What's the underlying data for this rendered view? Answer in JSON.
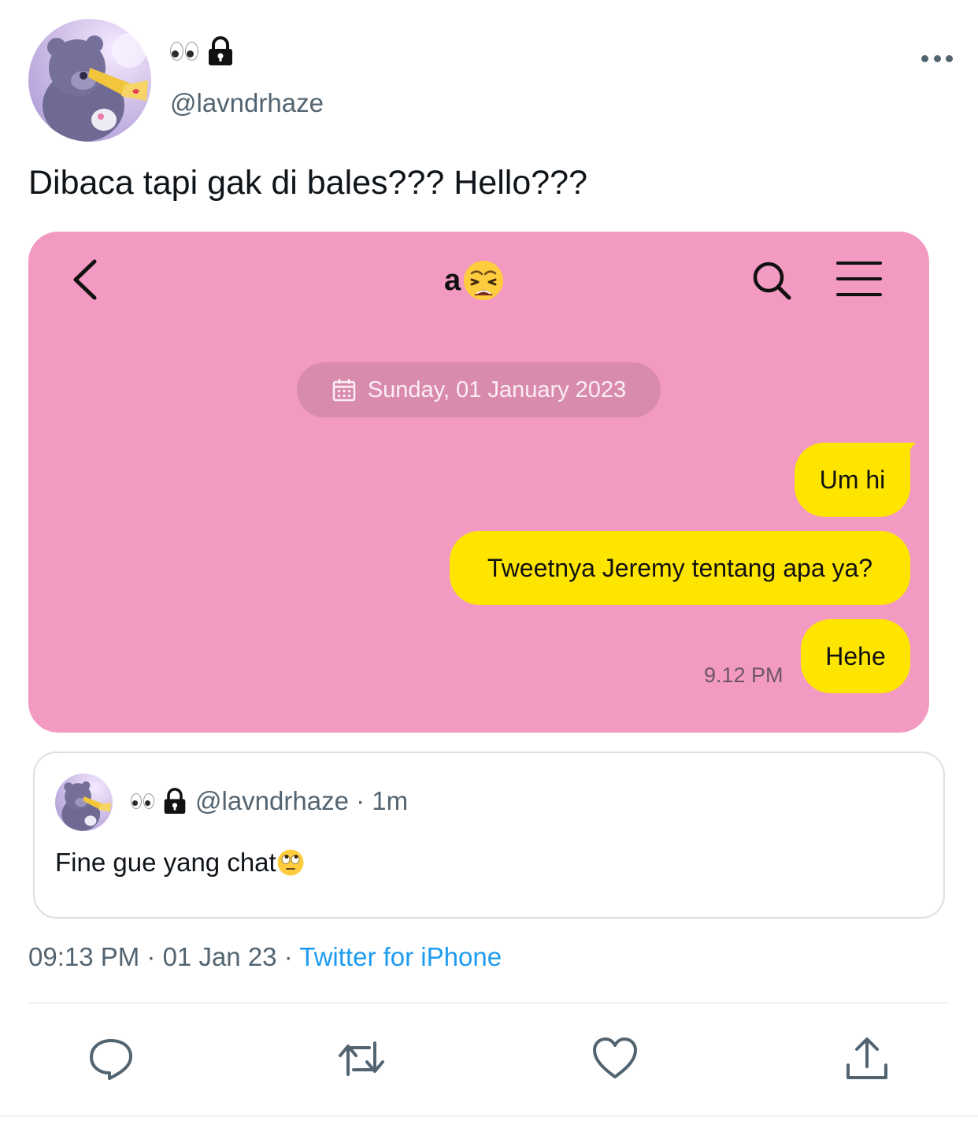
{
  "tweet": {
    "handle": "@lavndrhaze",
    "text": "Dibaca tapi gak di bales??? Hello???",
    "timestamp": "09:13 PM · 01 Jan 23 · ",
    "source": "Twitter for iPhone",
    "badges": [
      "eyes-emoji",
      "lock-icon"
    ],
    "more_icon": "more-horizontal-icon"
  },
  "chat": {
    "title": "a",
    "title_emoji": "weary-face-emoji",
    "date": "Sunday, 01 January 2023",
    "messages": [
      {
        "text": "Um hi"
      },
      {
        "text": "Tweetnya Jeremy tentang apa ya?"
      },
      {
        "text": "Hehe"
      }
    ],
    "time": "9.12 PM",
    "colors": {
      "background": "#f29ac2",
      "bubble": "#fee500"
    }
  },
  "quote": {
    "handle_time": "@lavndrhaze · 1m",
    "text": "Fine gue yang chat",
    "emoji": "face-with-rolling-eyes-emoji"
  },
  "actions": [
    "reply-icon",
    "retweet-icon",
    "like-icon",
    "share-icon"
  ],
  "colors": {
    "link": "#1d9bf0",
    "secondary_text": "#536471"
  }
}
